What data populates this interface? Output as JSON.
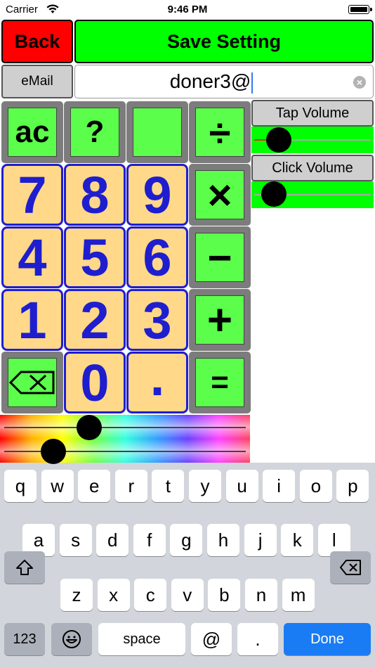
{
  "status_bar": {
    "carrier": "Carrier",
    "time": "9:46 PM"
  },
  "header": {
    "back_label": "Back",
    "save_label": "Save Setting"
  },
  "email": {
    "button_label": "eMail",
    "value": "doner3@"
  },
  "keypad": {
    "ops": {
      "clear": "ac",
      "help": "?",
      "divide": "÷",
      "multiply": "×",
      "minus": "−",
      "plus": "+",
      "equals": "="
    },
    "digits": [
      "7",
      "8",
      "9",
      "4",
      "5",
      "6",
      "1",
      "2",
      "3",
      "0",
      "."
    ]
  },
  "volume": {
    "tap_label": "Tap Volume",
    "tap_level": 0.15,
    "click_label": "Click Volume",
    "click_level": 0.1
  },
  "color_sliders": {
    "slider1_level": 0.34,
    "slider2_level": 0.18
  },
  "keyboard": {
    "row1": [
      "q",
      "w",
      "e",
      "r",
      "t",
      "y",
      "u",
      "i",
      "o",
      "p"
    ],
    "row2": [
      "a",
      "s",
      "d",
      "f",
      "g",
      "h",
      "j",
      "k",
      "l"
    ],
    "row3": [
      "z",
      "x",
      "c",
      "v",
      "b",
      "n",
      "m"
    ],
    "numbers_label": "123",
    "space_label": "space",
    "at_label": "@",
    "dot_label": ".",
    "done_label": "Done"
  },
  "colors": {
    "save_green": "#00ff00",
    "back_red": "#ff0000",
    "digit_blue": "#1e1ecf",
    "digit_bg": "#ffd88a",
    "op_green": "#5bff4b"
  }
}
